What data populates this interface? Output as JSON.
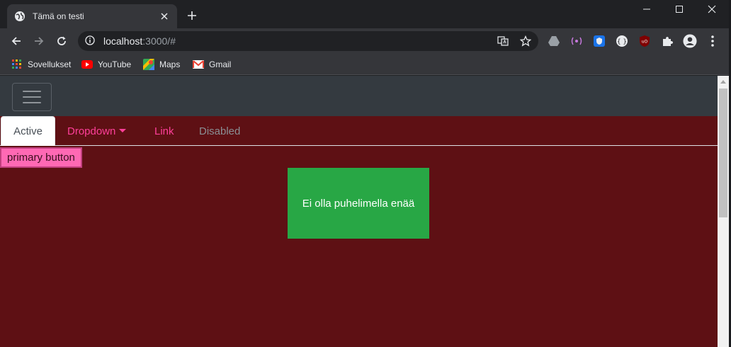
{
  "browser": {
    "tab_title": "Tämä on testi",
    "url_host": "localhost",
    "url_path": ":3000/#",
    "bookmarks": [
      {
        "label": "Sovellukset",
        "icon": "apps-grid-icon"
      },
      {
        "label": "YouTube",
        "icon": "youtube-icon"
      },
      {
        "label": "Maps",
        "icon": "maps-icon"
      },
      {
        "label": "Gmail",
        "icon": "gmail-icon"
      }
    ]
  },
  "page": {
    "nav_tabs": [
      {
        "label": "Active",
        "state": "active"
      },
      {
        "label": "Dropdown",
        "state": "dropdown"
      },
      {
        "label": "Link",
        "state": "link"
      },
      {
        "label": "Disabled",
        "state": "disabled"
      }
    ],
    "primary_button": "primary button",
    "green_box_text": "Ei olla puhelimella enää"
  },
  "colors": {
    "page_background": "#5e1014",
    "navbar": "#343a40",
    "nav_link": "#ff3f9a",
    "primary_button": "#ff69b4",
    "green_box": "#28a745"
  }
}
